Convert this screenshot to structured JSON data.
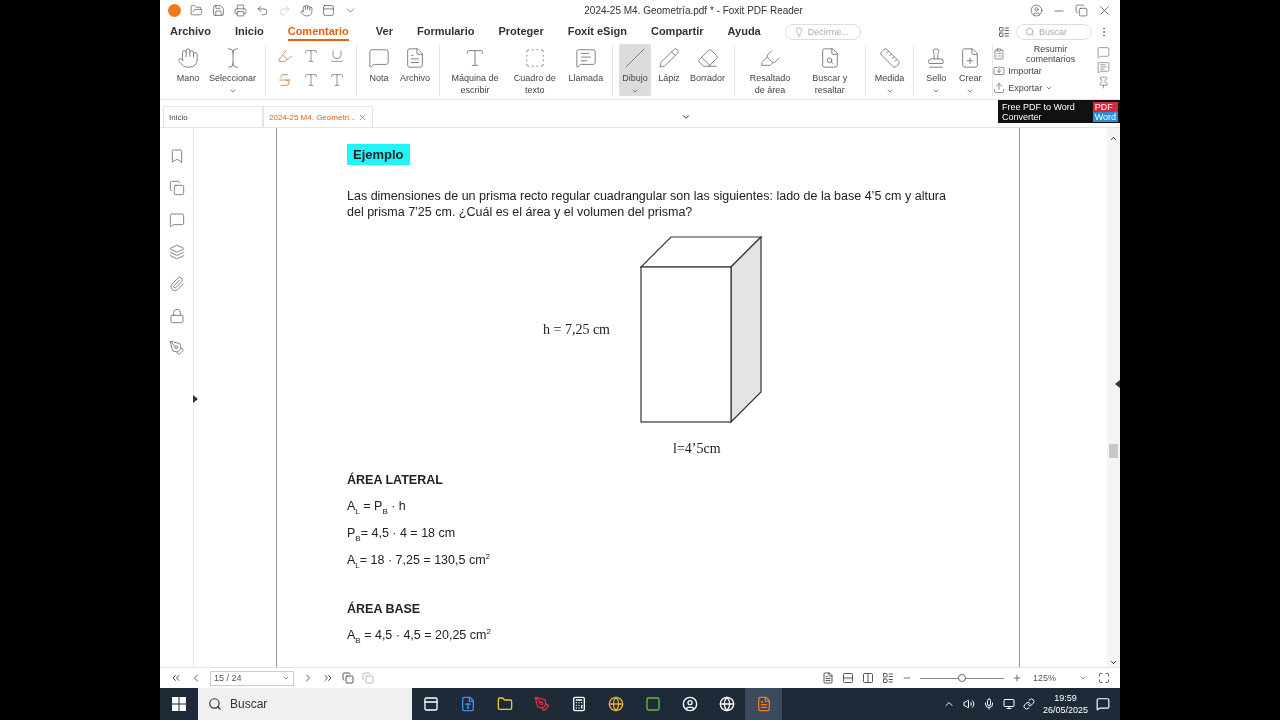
{
  "title_bar": {
    "title": "2024-25 M4. Geometría.pdf * - Foxit PDF Reader"
  },
  "menu_tabs": [
    {
      "label": "Archivo",
      "selected": false
    },
    {
      "label": "Inicio",
      "selected": false
    },
    {
      "label": "Comentario",
      "selected": true
    },
    {
      "label": "Ver",
      "selected": false
    },
    {
      "label": "Formulario",
      "selected": false
    },
    {
      "label": "Proteger",
      "selected": false
    },
    {
      "label": "Foxit eSign",
      "selected": false
    },
    {
      "label": "Compartir",
      "selected": false
    },
    {
      "label": "Ayuda",
      "selected": false
    }
  ],
  "tell_me": {
    "placeholder": "Decirme..."
  },
  "search": {
    "placeholder": "Buscar"
  },
  "ribbon": {
    "groups": [
      {
        "kind": "buttons",
        "items": [
          {
            "label": "Mano",
            "selected": false,
            "dropdown": false
          },
          {
            "label": "Seleccionar",
            "selected": false,
            "dropdown": true
          }
        ]
      },
      {
        "kind": "icon_grid"
      },
      {
        "kind": "buttons",
        "items": [
          {
            "label": "Nota",
            "selected": false,
            "dropdown": false
          },
          {
            "label": "Archivo",
            "selected": false,
            "dropdown": false
          }
        ]
      },
      {
        "kind": "buttons",
        "items": [
          {
            "label": "Máquina de escribir",
            "selected": false,
            "dropdown": false
          },
          {
            "label": "Cuadro de texto",
            "selected": false,
            "dropdown": false
          },
          {
            "label": "Llamada",
            "selected": false,
            "dropdown": false
          }
        ]
      },
      {
        "kind": "buttons",
        "items": [
          {
            "label": "Dibujo",
            "selected": true,
            "dropdown": true
          },
          {
            "label": "Lápiz",
            "selected": false,
            "dropdown": false
          },
          {
            "label": "Borrador",
            "selected": false,
            "dropdown": false
          }
        ]
      },
      {
        "kind": "buttons",
        "items": [
          {
            "label": "Resaltado de área",
            "selected": false,
            "dropdown": false
          },
          {
            "label": "Buscar y resaltar",
            "selected": false,
            "dropdown": false
          }
        ]
      },
      {
        "kind": "buttons",
        "items": [
          {
            "label": "Medida",
            "selected": false,
            "dropdown": true
          }
        ]
      },
      {
        "kind": "buttons",
        "items": [
          {
            "label": "Sello",
            "selected": false,
            "dropdown": true
          },
          {
            "label": "Crear",
            "selected": false,
            "dropdown": true
          }
        ]
      },
      {
        "kind": "list",
        "items": [
          {
            "label": "Resumir comentarios",
            "dropdown": false
          },
          {
            "label": "Importar",
            "dropdown": false
          },
          {
            "label": "Exportar",
            "dropdown": true
          }
        ]
      }
    ]
  },
  "doc_tabs": [
    {
      "label": "Inicio",
      "selected": false
    },
    {
      "label": "2024-25 M4. Geometri...",
      "selected": true
    }
  ],
  "ad": {
    "text": "Free PDF to Word Converter",
    "badge_top": "PDF",
    "badge_bottom": "Word"
  },
  "page": {
    "heading": "Ejemplo",
    "paragraph": "Las dimensiones de un prisma recto regular cuadrangular son las siguientes: lado de la base 4’5 cm y altura del prisma 7’25 cm. ¿Cuál es el área y el volumen del prisma?",
    "figure": {
      "height_label": "h = 7,25 cm",
      "side_label": "l=4’5cm"
    },
    "sections": [
      {
        "title": "ÁREA LATERAL",
        "formulas": [
          "A$_{L}$ = P$_{B}$ · h",
          "P$_{B}$= 4,5 · 4 = 18 cm",
          "A$_{L}$= 18 · 7,25 = 130,5 cm$^{2}$"
        ]
      },
      {
        "title": "ÁREA BASE",
        "formulas": [
          "A$_{B}$ = 4,5 · 4,5 = 20,25 cm$^{2}$"
        ]
      }
    ]
  },
  "status_bar": {
    "page_field": "15 / 24",
    "zoom_slider": {
      "level": 0.5
    },
    "zoom_value": "125%"
  },
  "taskbar": {
    "search_placeholder": "Buscar",
    "time": "19:59",
    "date": "26/05/2025"
  }
}
